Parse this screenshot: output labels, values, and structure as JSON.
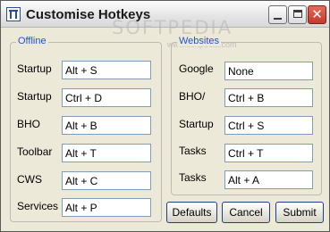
{
  "window": {
    "title": "Customise Hotkeys",
    "watermark": "SOFTPEDIA",
    "watermark_sub": "www.softpedia.com",
    "close_glyph": "✕"
  },
  "offline": {
    "title": "Offline",
    "rows": [
      {
        "label": "Startup",
        "value": "Alt + S"
      },
      {
        "label": "Startup",
        "value": "Ctrl + D"
      },
      {
        "label": "BHO",
        "value": "Alt + B"
      },
      {
        "label": "Toolbar",
        "value": "Alt + T"
      },
      {
        "label": "CWS",
        "value": "Alt + C"
      },
      {
        "label": "Services",
        "value": "Alt + P"
      }
    ]
  },
  "websites": {
    "title": "Websites",
    "rows": [
      {
        "label": "Google",
        "value": "None"
      },
      {
        "label": "BHO/",
        "value": "Ctrl + B"
      },
      {
        "label": "Startup",
        "value": "Ctrl + S"
      },
      {
        "label": "Tasks",
        "value": "Ctrl + T"
      },
      {
        "label": "Tasks",
        "value": "Alt + A"
      }
    ]
  },
  "buttons": {
    "defaults": "Defaults",
    "cancel": "Cancel",
    "submit": "Submit"
  },
  "colors": {
    "group_title": "#1f53d0",
    "close_button": "#c23b2b",
    "field_border": "#7f9db9"
  },
  "icons": {
    "app": "hotkeys-app-icon",
    "minimize": "minimize-icon",
    "maximize": "maximize-icon",
    "close": "close-icon"
  }
}
